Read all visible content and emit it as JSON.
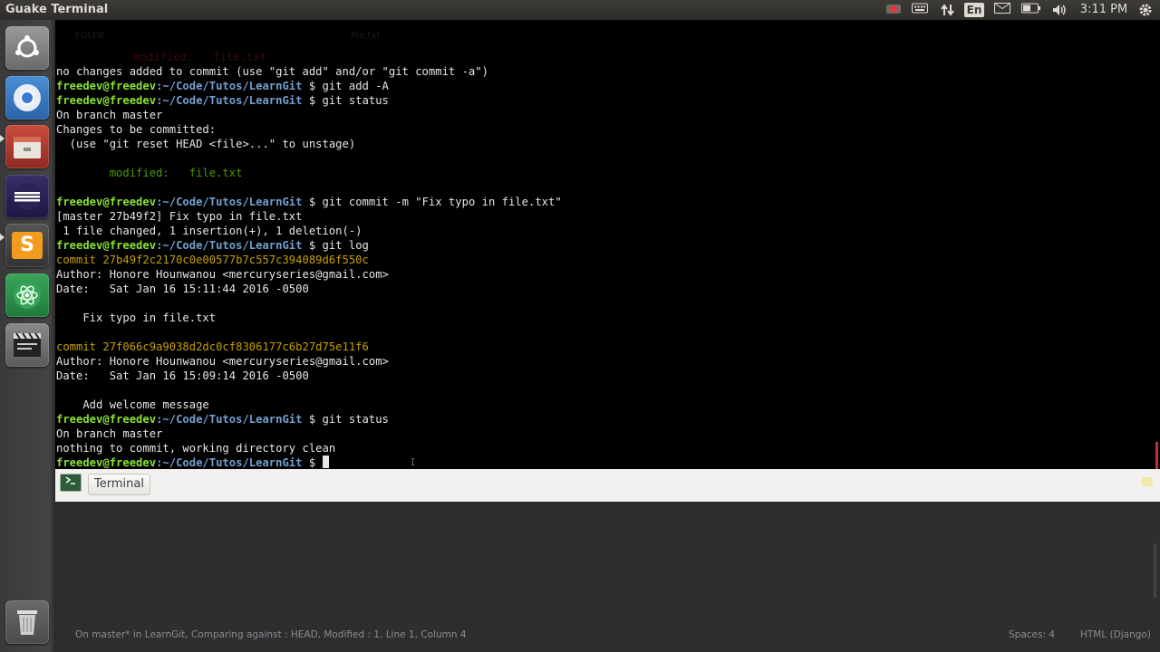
{
  "topbar": {
    "title": "Guake Terminal",
    "tray": {
      "record_icon": "record-icon",
      "keyboard_icon": "keyboard-icon",
      "network_icon": "network-updown-icon",
      "language": "En",
      "mail_icon": "envelope-icon",
      "battery_icon": "battery-icon",
      "volume_icon": "volume-icon",
      "time": "3:11 PM",
      "power_icon": "gear-icon"
    }
  },
  "launcher": {
    "items": [
      {
        "name": "ubuntu-logo-icon"
      },
      {
        "name": "chromium-icon"
      },
      {
        "name": "files-icon"
      },
      {
        "name": "eclipse-icon"
      },
      {
        "name": "sublime-text-icon"
      },
      {
        "name": "atom-icon"
      },
      {
        "name": "video-editor-icon"
      },
      {
        "name": "trash-icon"
      }
    ],
    "sublime_letter": "S"
  },
  "terminal": {
    "ghost_header": {
      "left": "FOLDE",
      "modified": "modified:",
      "file": "file.txt",
      "tabfile": "file.txt"
    },
    "prompt_user": "freedev@freedev",
    "prompt_path": ":~/Code/Tutos/LearnGit",
    "prompt_sign": " $ ",
    "lines": {
      "l1": "no changes added to commit (use \"git add\" and/or \"git commit -a\")",
      "cmd1": "git add -A",
      "cmd2": "git status",
      "l4": "On branch master",
      "l5": "Changes to be committed:",
      "l6": "  (use \"git reset HEAD <file>...\" to unstage)",
      "mod_label": "        modified:   file.txt",
      "cmd3": "git commit -m \"Fix typo in file.txt\"",
      "l10": "[master 27b49f2] Fix typo in file.txt",
      "l11": " 1 file changed, 1 insertion(+), 1 deletion(-)",
      "cmd4": "git log",
      "commit1": "commit 27b49f2c2170c0e00577b7c557c394089d6f550c",
      "author1": "Author: Honore Hounwanou <mercuryseries@gmail.com>",
      "date1": "Date:   Sat Jan 16 15:11:44 2016 -0500",
      "msg1": "    Fix typo in file.txt",
      "commit2": "commit 27f066c9a9038d2dc0cf8306177c6b27d75e11f6",
      "author2": "Author: Honore Hounwanou <mercuryseries@gmail.com>",
      "date2": "Date:   Sat Jan 16 15:09:14 2016 -0500",
      "msg2": "    Add welcome message",
      "cmd5": "git status",
      "l24": "On branch master",
      "l25": "nothing to commit, working directory clean"
    }
  },
  "tabbar": {
    "tab_label": "Terminal",
    "tab_icon": "terminal-tab-icon"
  },
  "statusbar": {
    "left": "On master* in LearnGit, Comparing against : HEAD, Modified : 1, Line 1, Column 4",
    "spaces": "Spaces: 4",
    "syntax": "HTML (Django)"
  }
}
